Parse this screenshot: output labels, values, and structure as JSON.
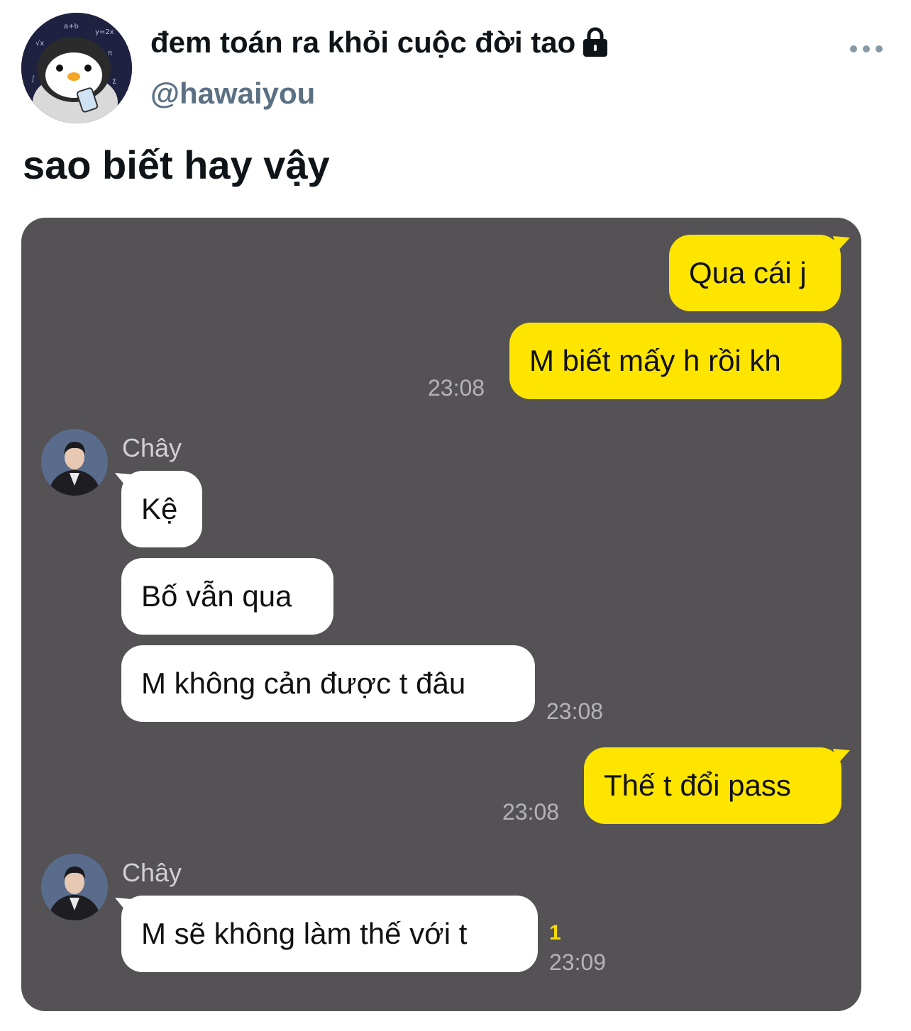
{
  "tweet": {
    "display_name": "đem toán ra khỏi cuộc đời tao",
    "handle": "@hawaiyou",
    "text": "sao biết hay vậy"
  },
  "colors": {
    "outgoing_bubble": "#fee500",
    "incoming_bubble": "#ffffff",
    "chat_background": "#545255",
    "unread_count": "#f5d90a"
  },
  "chat": {
    "messages": [
      {
        "id": "m1",
        "from": "me",
        "text": "Qua cái j"
      },
      {
        "id": "m2",
        "from": "me",
        "text": "M biết mấy h rồi kh",
        "time": "23:08"
      },
      {
        "id": "m3",
        "from": "Chây",
        "sender": "Chây",
        "text": "Kệ"
      },
      {
        "id": "m4",
        "from": "Chây",
        "text": "Bố vẫn qua"
      },
      {
        "id": "m5",
        "from": "Chây",
        "text": "M không cản được t đâu",
        "time": "23:08"
      },
      {
        "id": "m6",
        "from": "me",
        "text": "Thế t đổi pass",
        "time": "23:08"
      },
      {
        "id": "m7",
        "from": "Chây",
        "sender": "Chây",
        "text": "M sẽ không làm thế với t",
        "unread": "1",
        "time": "23:09"
      }
    ]
  },
  "icons": [
    "lock-icon",
    "more-icon",
    "profile-avatar",
    "contact-avatar"
  ]
}
